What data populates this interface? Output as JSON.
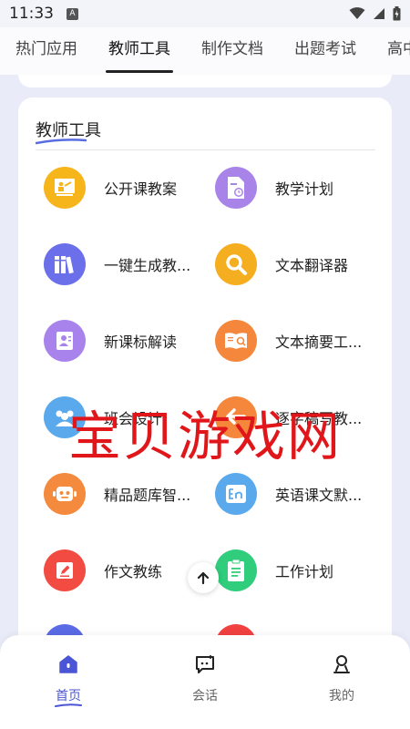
{
  "status": {
    "time": "11:33",
    "notif": "A"
  },
  "tabs": [
    {
      "label": "热门应用",
      "active": false
    },
    {
      "label": "教师工具",
      "active": true
    },
    {
      "label": "制作文档",
      "active": false
    },
    {
      "label": "出题考试",
      "active": false
    },
    {
      "label": "高中",
      "active": false
    }
  ],
  "card": {
    "title": "教师工具"
  },
  "tools": [
    {
      "label": "公开课教案",
      "icon": "lecture-icon",
      "color": "#f7b51c"
    },
    {
      "label": "教学计划",
      "icon": "document-clock-icon",
      "color": "#a883e8"
    },
    {
      "label": "一键生成教...",
      "icon": "books-icon",
      "color": "#6b6fe9"
    },
    {
      "label": "文本翻译器",
      "icon": "magnifier-icon",
      "color": "#f4ae1f"
    },
    {
      "label": "新课标解读",
      "icon": "person-doc-icon",
      "color": "#a983ec"
    },
    {
      "label": "文本摘要工...",
      "icon": "open-book-icon",
      "color": "#f4873c"
    },
    {
      "label": "班会设计",
      "icon": "group-icon",
      "color": "#5aa9ec"
    },
    {
      "label": "逐字稿写教...",
      "icon": "arrow-back-icon",
      "color": "#f4873c"
    },
    {
      "label": "精品题库智...",
      "icon": "robot-icon",
      "color": "#f48a3e"
    },
    {
      "label": "英语课文默...",
      "icon": "en-icon",
      "color": "#5aa9ec"
    },
    {
      "label": "作文教练",
      "icon": "pen-edit-icon",
      "color": "#f24b41"
    },
    {
      "label": "工作计划",
      "icon": "clipboard-icon",
      "color": "#2fcd7c"
    }
  ],
  "watermark": "宝贝游戏网",
  "nav": [
    {
      "label": "首页",
      "icon": "home-icon",
      "active": true
    },
    {
      "label": "会话",
      "icon": "chat-icon",
      "active": false
    },
    {
      "label": "我的",
      "icon": "profile-icon",
      "active": false
    }
  ],
  "colors": {
    "accent": "#4b56d6",
    "background": "#e9ecf8"
  }
}
